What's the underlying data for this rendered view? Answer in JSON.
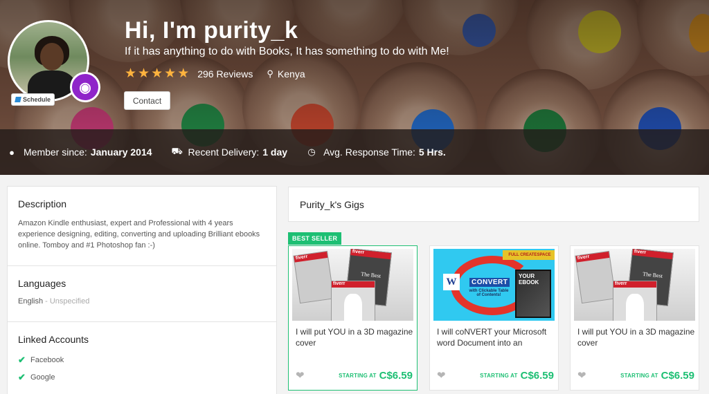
{
  "profile": {
    "greeting": "Hi, I'm purity_k",
    "tagline": "If it has anything to do with Books, It has something to do with Me!",
    "rating_stars": 5,
    "reviews": "296 Reviews",
    "location": "Kenya",
    "contact_label": "Contact",
    "schedule_label": "Schedule",
    "level_badge_icon": "medal-icon"
  },
  "stats": {
    "member_label": "Member since:",
    "member_value": "January 2014",
    "delivery_label": "Recent Delivery:",
    "delivery_value": "1 day",
    "response_label": "Avg. Response Time:",
    "response_value": "5 Hrs."
  },
  "sidebar": {
    "description_title": "Description",
    "description_text": "Amazon Kindle enthusiast, expert and Professional with 4 years experience designing, editing, converting and uploading Brilliant ebooks online. Tomboy and #1 Photoshop fan :-)",
    "languages_title": "Languages",
    "language_name": "English",
    "language_level": " - Unspecified",
    "linked_title": "Linked Accounts",
    "linked": [
      "Facebook",
      "Google"
    ]
  },
  "gigs": {
    "header": "Purity_k's Gigs",
    "best_seller_label": "BEST SELLER",
    "starting_label": "STARTING AT",
    "items": [
      {
        "title": "I will put YOU in a 3D magazine cover",
        "price": "C$6.59"
      },
      {
        "title": "I will coNVERT your Microsoft word Document into an",
        "price": "C$6.59"
      },
      {
        "title": "I will put YOU in a 3D magazine cover",
        "price": "C$6.59"
      }
    ],
    "image_text": {
      "mag_brand": "fiverr",
      "mag_side": "The Best",
      "convert_w": "W",
      "convert_word": "CONVERT",
      "convert_sub": "with Clickable Table of Contents!",
      "convert_banner": "FULL CREATESPACE",
      "convert_book": "YOUR EBOOK"
    }
  },
  "colors": {
    "accent_green": "#1dbf73",
    "star_yellow": "#ffb33e",
    "level_purple": "#8f24c9"
  }
}
